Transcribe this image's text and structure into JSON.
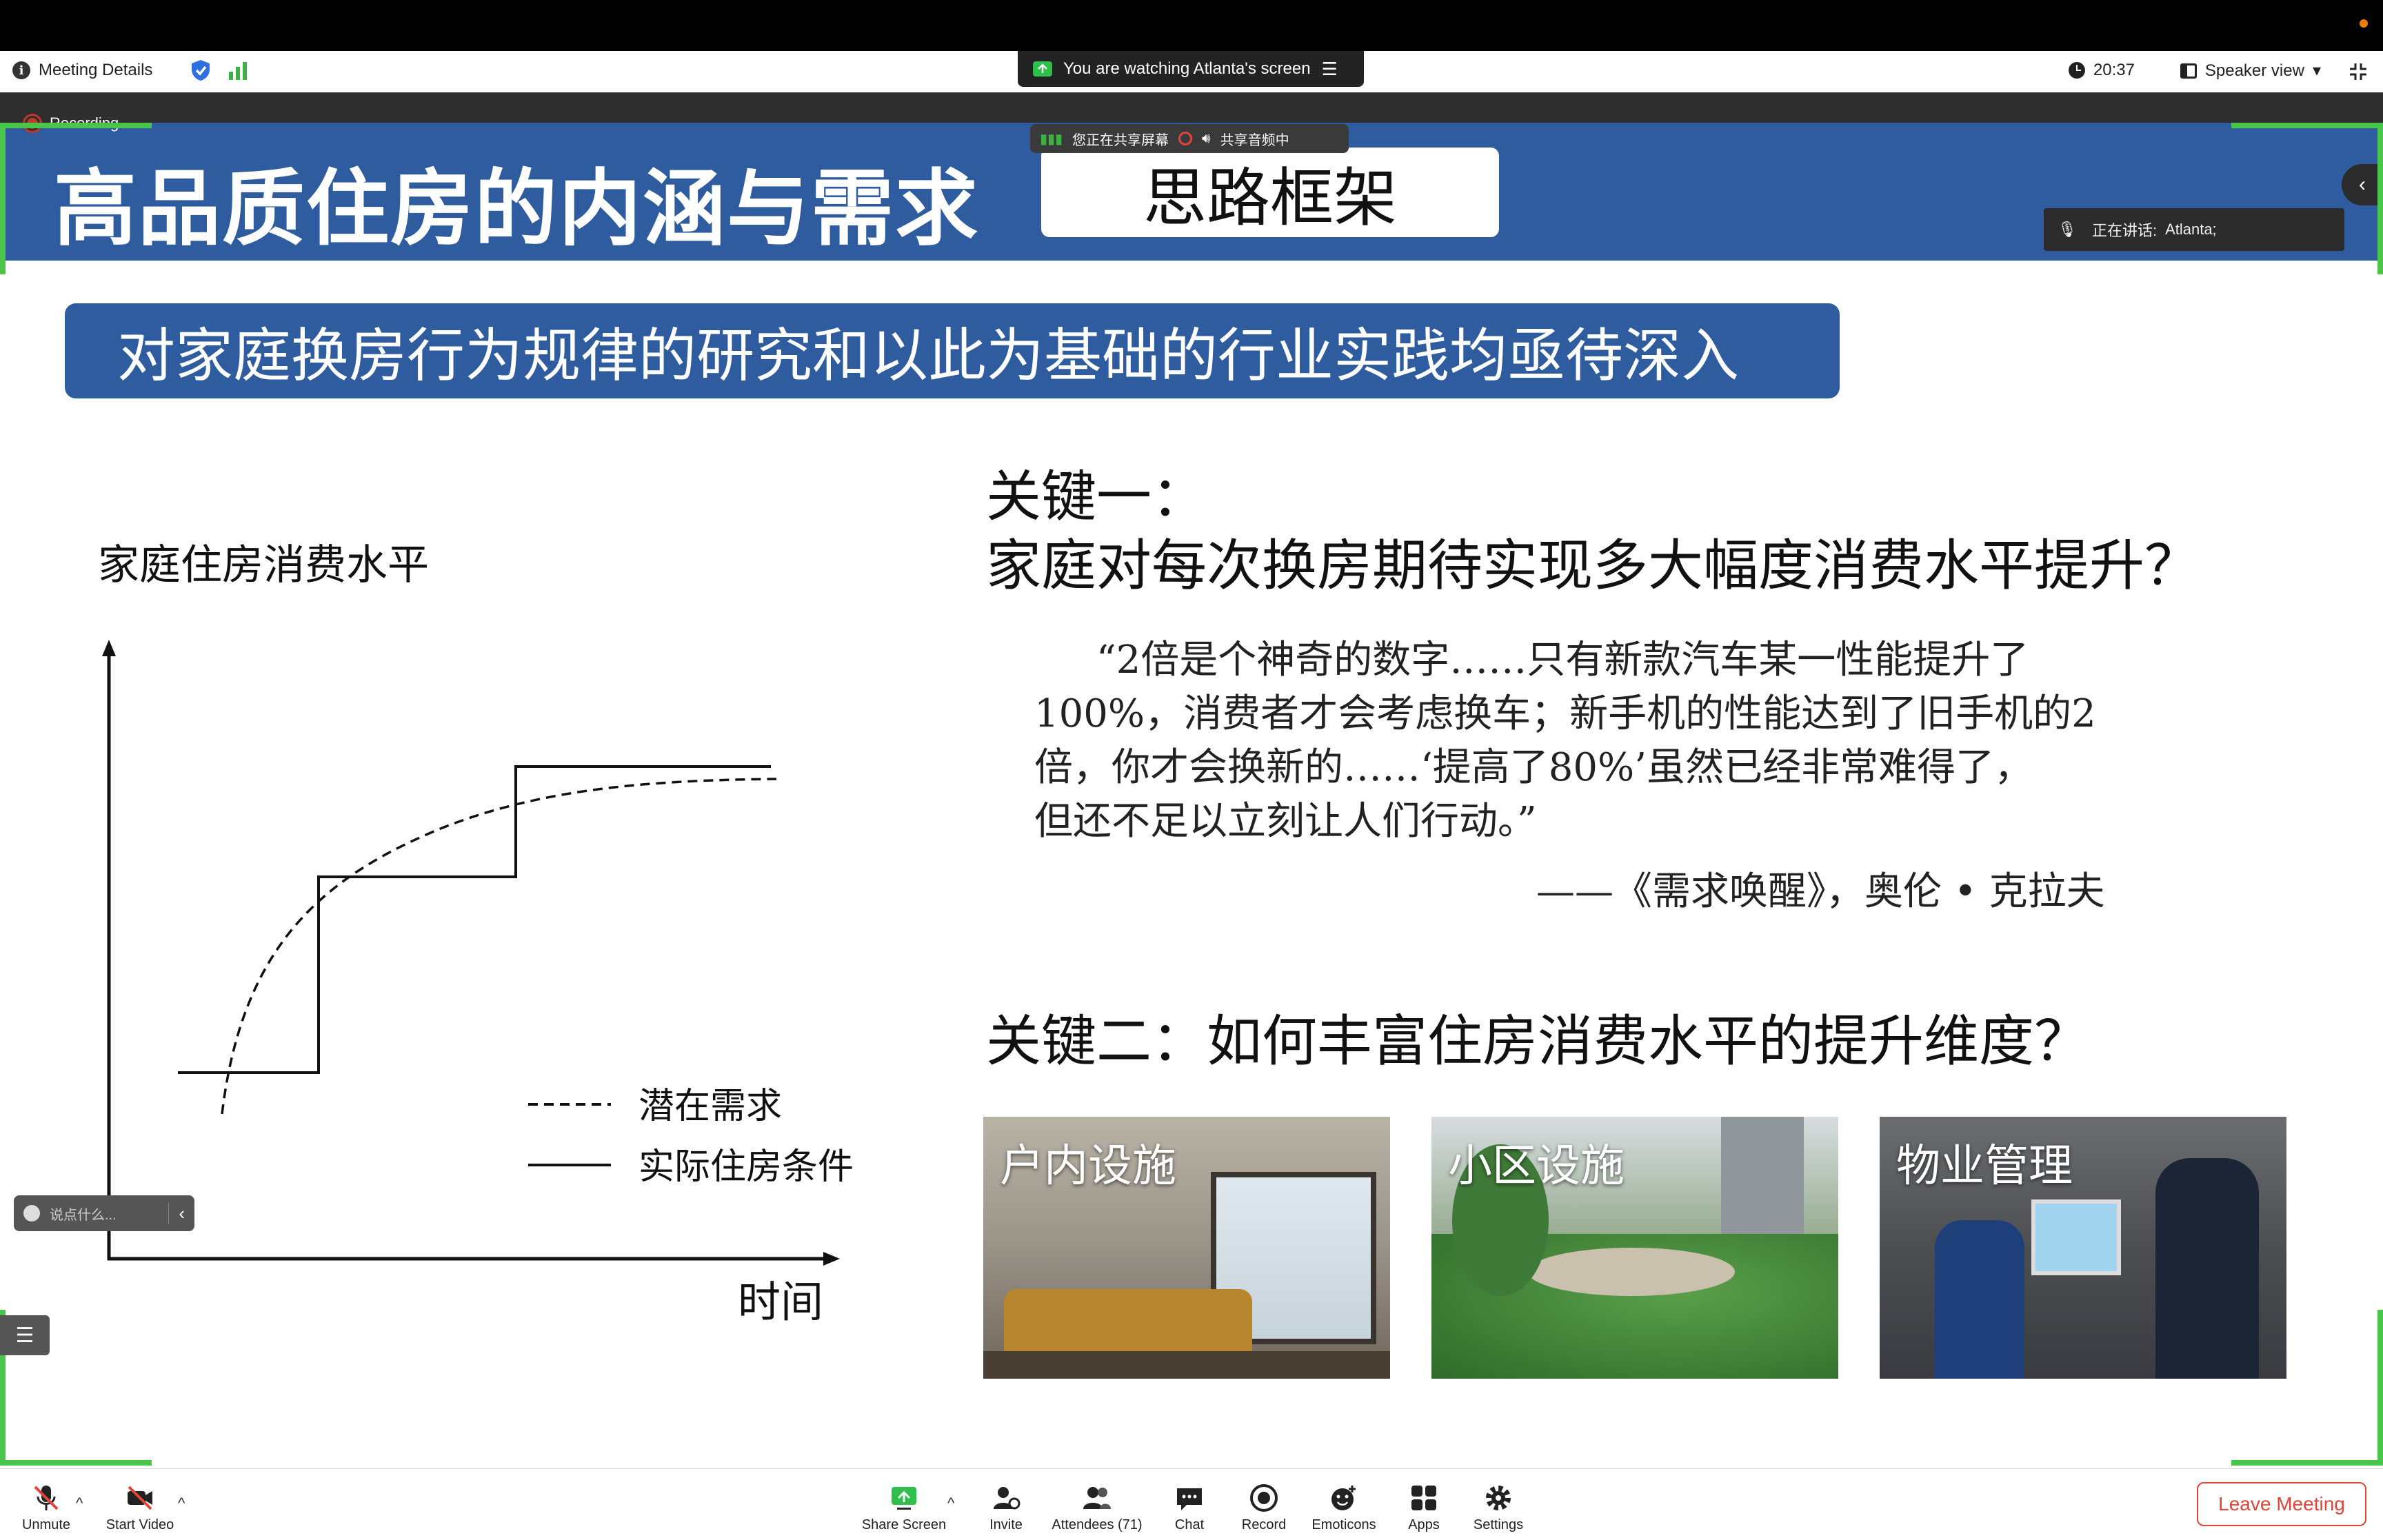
{
  "top_bar": {
    "meeting_details": "Meeting Details",
    "watching": "You are watching Atlanta's screen",
    "time": "20:37",
    "speaker_view": "Speaker view"
  },
  "recording": {
    "label": "Recording"
  },
  "sharing_indicator": {
    "sharing_label": "您正在共享屏幕",
    "audio_label": "共享音频中"
  },
  "speaking": {
    "label": "正在讲话:",
    "name": "Atlanta;"
  },
  "slide": {
    "title": "高品质住房的内涵与需求",
    "frame_label": "思路框架",
    "banner": "对家庭换房行为规律的研究和以此为基础的行业实践均亟待深入",
    "chart": {
      "y_label": "家庭住房消费水平",
      "x_label": "时间",
      "legend_dashed": "潜在需求",
      "legend_solid": "实际住房条件"
    },
    "key1_title": "关键一：",
    "key1_question": "家庭对每次换房期待实现多大幅度消费水平提升？",
    "quote_lines": [
      "“2倍是个神奇的数字……只有新款汽车某一性能提升了",
      "100%，消费者才会考虑换车；新手机的性能达到了旧手机的2",
      "倍，你才会换新的……‘提高了80%’虽然已经非常难得了，",
      "但还不足以立刻让人们行动。”"
    ],
    "quote_source": "——《需求唤醒》，奥伦 • 克拉夫",
    "key2": "关键二：如何丰富住房消费水平的提升维度？",
    "photos": [
      "户内设施",
      "小区设施",
      "物业管理"
    ]
  },
  "widgets": {
    "caption_placeholder": "说点什么..."
  },
  "toolbar": {
    "unmute": "Unmute",
    "start_video": "Start Video",
    "share_screen": "Share Screen",
    "invite": "Invite",
    "attendees": "Attendees (71)",
    "chat": "Chat",
    "record": "Record",
    "emoticons": "Emoticons",
    "apps": "Apps",
    "settings": "Settings",
    "leave": "Leave Meeting"
  },
  "colors": {
    "slide_blue": "#2e5c9e",
    "green_frame": "#49c64a",
    "leave_red": "#e0453a"
  }
}
